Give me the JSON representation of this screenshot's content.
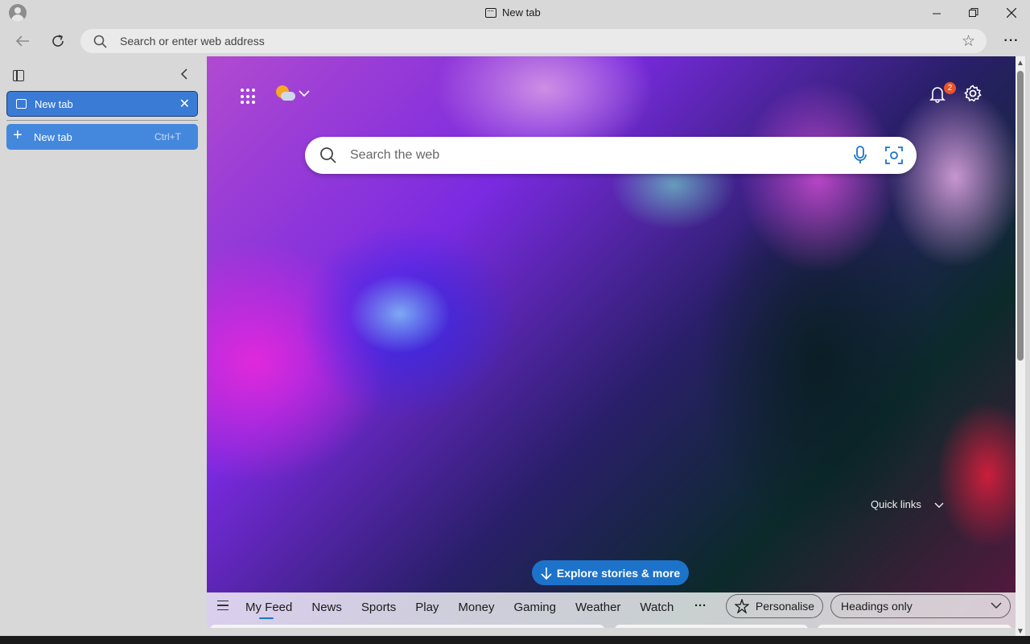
{
  "window": {
    "title": "New tab",
    "icons": {
      "profile": "profile-avatar",
      "minimize": "minimize-icon",
      "restore": "restore-icon",
      "close": "close-icon"
    }
  },
  "toolbar": {
    "address_placeholder": "Search or enter web address",
    "icons": {
      "back": "back-arrow-icon",
      "refresh": "refresh-icon",
      "search": "search-icon",
      "favorite": "star-icon",
      "more": "more-icon"
    }
  },
  "sidebar": {
    "tabs": [
      {
        "label": "New tab",
        "active": true
      }
    ],
    "new_tab": {
      "label": "New tab",
      "shortcut": "Ctrl+T"
    }
  },
  "newtab_page": {
    "search_placeholder": "Search the web",
    "notification_count": "2",
    "quick_links_label": "Quick links",
    "explore_label": "Explore stories & more",
    "feed_tabs": [
      "My Feed",
      "News",
      "Sports",
      "Play",
      "Money",
      "Gaming",
      "Weather",
      "Watch"
    ],
    "feed_more": "···",
    "personalise_label": "Personalise",
    "layout_select": "Headings only",
    "colors": {
      "accent": "#1d73c9",
      "sidebar_tab": "#3a7bd5",
      "badge": "#e8532a"
    }
  }
}
